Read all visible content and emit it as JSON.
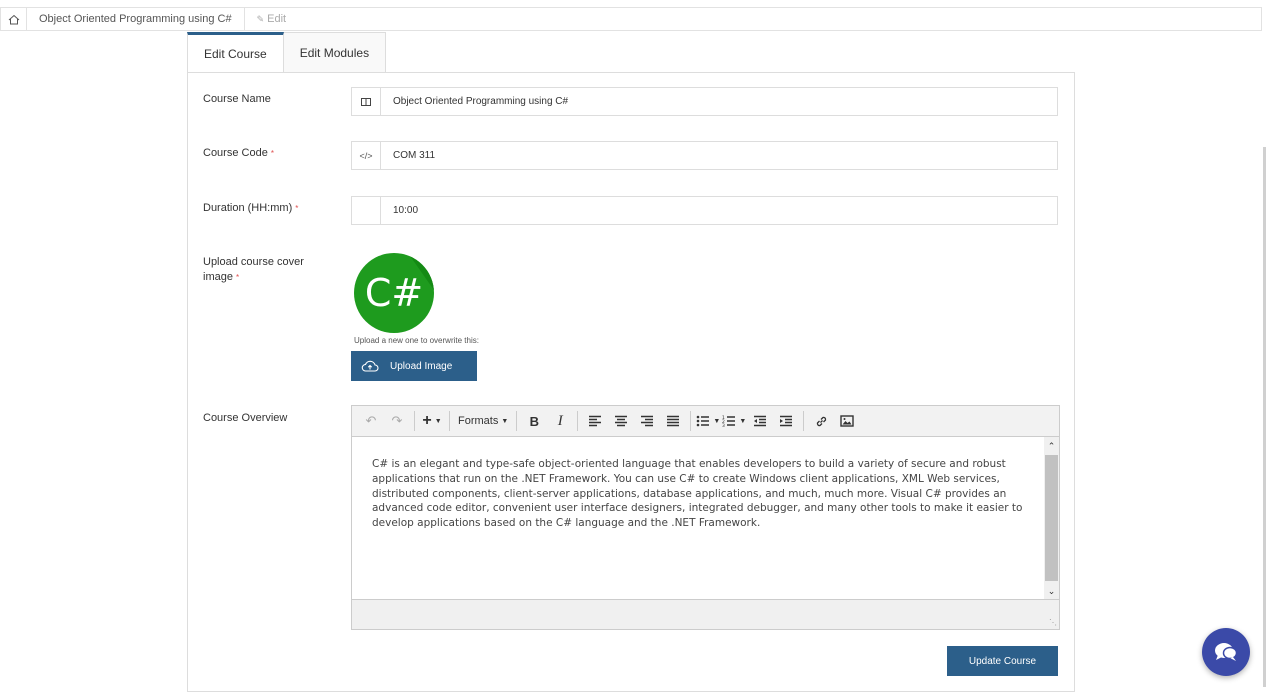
{
  "breadcrumb": {
    "course": "Object Oriented Programming using C#",
    "current": "Edit"
  },
  "tabs": [
    {
      "label": "Edit Course",
      "active": true
    },
    {
      "label": "Edit Modules",
      "active": false
    }
  ],
  "form": {
    "course_name": {
      "label": "Course Name",
      "value": "Object Oriented Programming using C#"
    },
    "course_code": {
      "label": "Course Code",
      "required": "*",
      "value": "COM 311"
    },
    "duration": {
      "label": "Duration (HH:mm)",
      "required": "*",
      "value": "10:00"
    },
    "cover": {
      "label": "Upload course cover image",
      "required": "*",
      "image_text": "C#",
      "hint": "Upload a new one to overwrite this:",
      "upload_label": "Upload Image"
    },
    "overview": {
      "label": "Course Overview",
      "formats_label": "Formats",
      "text": "C# is an elegant and type-safe object-oriented language that enables developers to build a variety of secure and robust applications that run on the .NET Framework. You can use C# to create Windows client applications, XML Web services, distributed components, client-server applications, database applications, and much, much more. Visual C# provides an advanced code editor, convenient user interface designers, integrated debugger, and many other tools to make it easier to develop applications based on the C# language and the .NET Framework."
    },
    "submit_label": "Update Course"
  },
  "colors": {
    "primary": "#2c5f8a",
    "chat": "#3b4aa8",
    "cover_green": "#1e9b1e"
  }
}
